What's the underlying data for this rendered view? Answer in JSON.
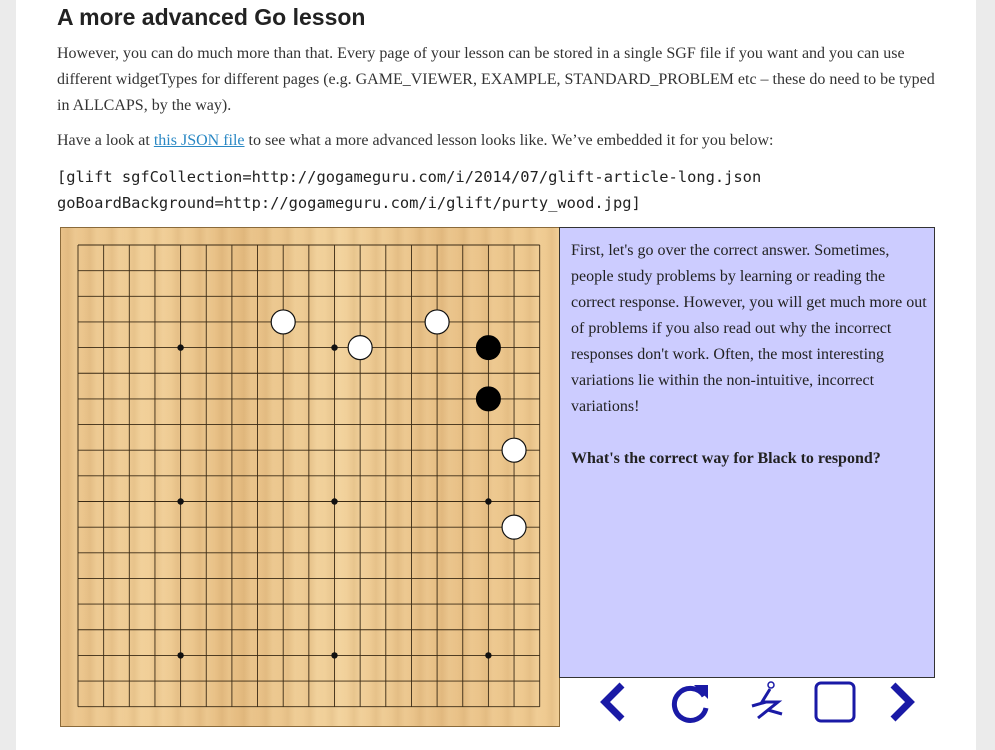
{
  "article": {
    "heading": "A more advanced Go lesson",
    "para1": "However, you can do much more than that. Every page of your lesson can be stored in a single SGF file if you want and you can use different widgetTypes for different pages (e.g. GAME_VIEWER, EXAMPLE, STANDARD_PROBLEM etc – these do need to be typed in ALLCAPS, by the way).",
    "para2_before": "Have a look at ",
    "para2_link": "this JSON file",
    "para2_after": " to see what a more advanced lesson looks like. We’ve embedded it for you below:",
    "code_line1": "[glift sgfCollection=http://gogameguru.com/i/2014/07/glift-article-long.json",
    "code_line2": "goBoardBackground=http://gogameguru.com/i/glift/purty_wood.jpg]"
  },
  "board": {
    "visible_cols": 19,
    "visible_rows": 19,
    "star_points": [
      [
        4,
        4
      ],
      [
        10,
        4
      ],
      [
        16,
        4
      ],
      [
        4,
        10
      ],
      [
        10,
        10
      ],
      [
        16,
        10
      ],
      [
        4,
        16
      ],
      [
        10,
        16
      ],
      [
        16,
        16
      ]
    ],
    "stones": [
      {
        "color": "white",
        "col": 8,
        "row": 3
      },
      {
        "color": "white",
        "col": 11,
        "row": 4
      },
      {
        "color": "white",
        "col": 14,
        "row": 3
      },
      {
        "color": "black",
        "col": 16,
        "row": 4
      },
      {
        "color": "black",
        "col": 16,
        "row": 6
      },
      {
        "color": "white",
        "col": 17,
        "row": 8
      },
      {
        "color": "white",
        "col": 17,
        "row": 11
      }
    ]
  },
  "commentary": {
    "text": "First, let's go over the correct answer. Sometimes, people study problems by learning or reading the correct response. However, you will get much more out of problems if you also read out why the incorrect responses don't work. Often, the most interesting variations lie within the non-intuitive, incorrect variations!",
    "question": "What's the correct way for Black to respond?"
  },
  "controls": {
    "color": "#1a1aa6",
    "icons": [
      "chevron-left-icon",
      "refresh-icon",
      "explore-problem-icon",
      "board-editor-icon",
      "chevron-right-icon"
    ]
  }
}
